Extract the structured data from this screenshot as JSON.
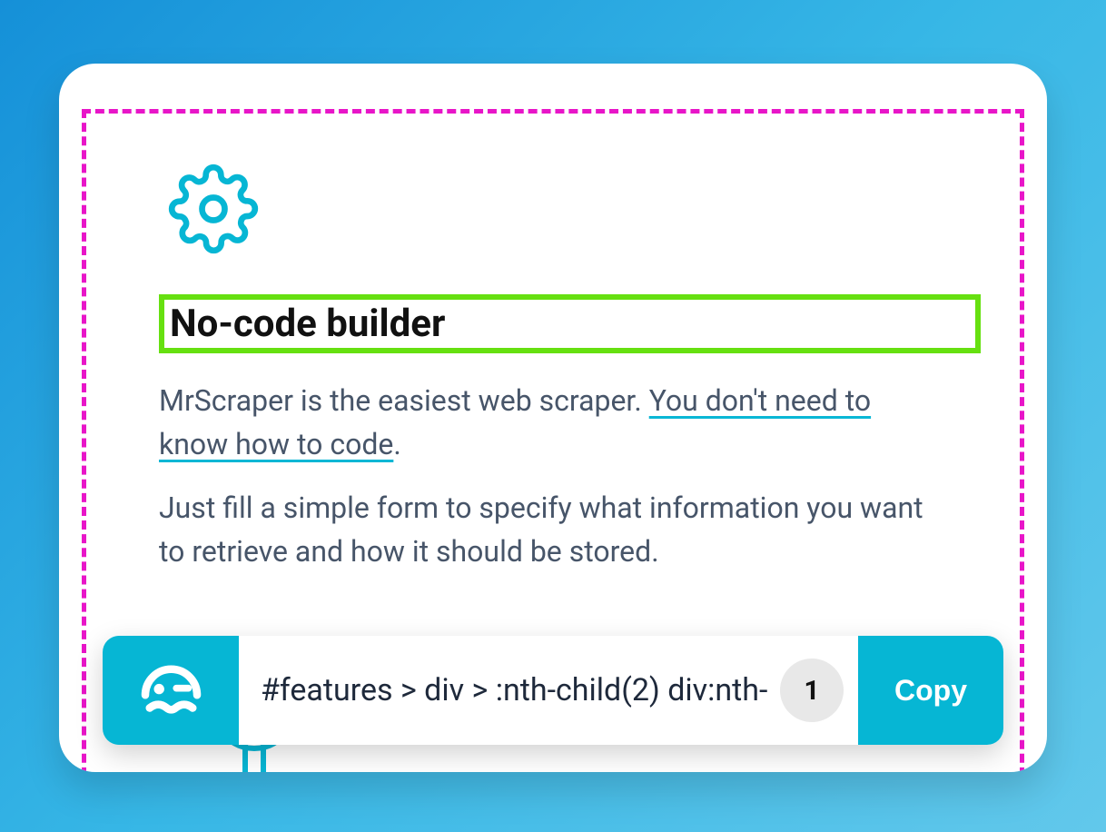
{
  "card": {
    "heading": "No-code builder",
    "paragraph1_prefix": "MrScraper is the easiest web scraper. ",
    "paragraph1_link": "You don't need to know how to code",
    "paragraph1_suffix": ".",
    "paragraph2": "Just fill a simple form to specify what information you want to retrieve and how it should be stored."
  },
  "selector_bar": {
    "selector_text": "#features > div > :nth-child(2) div:nth-",
    "match_count": "1",
    "copy_label": "Copy"
  },
  "icons": {
    "gear": "gear-icon",
    "logo": "mrscraper-logo"
  }
}
